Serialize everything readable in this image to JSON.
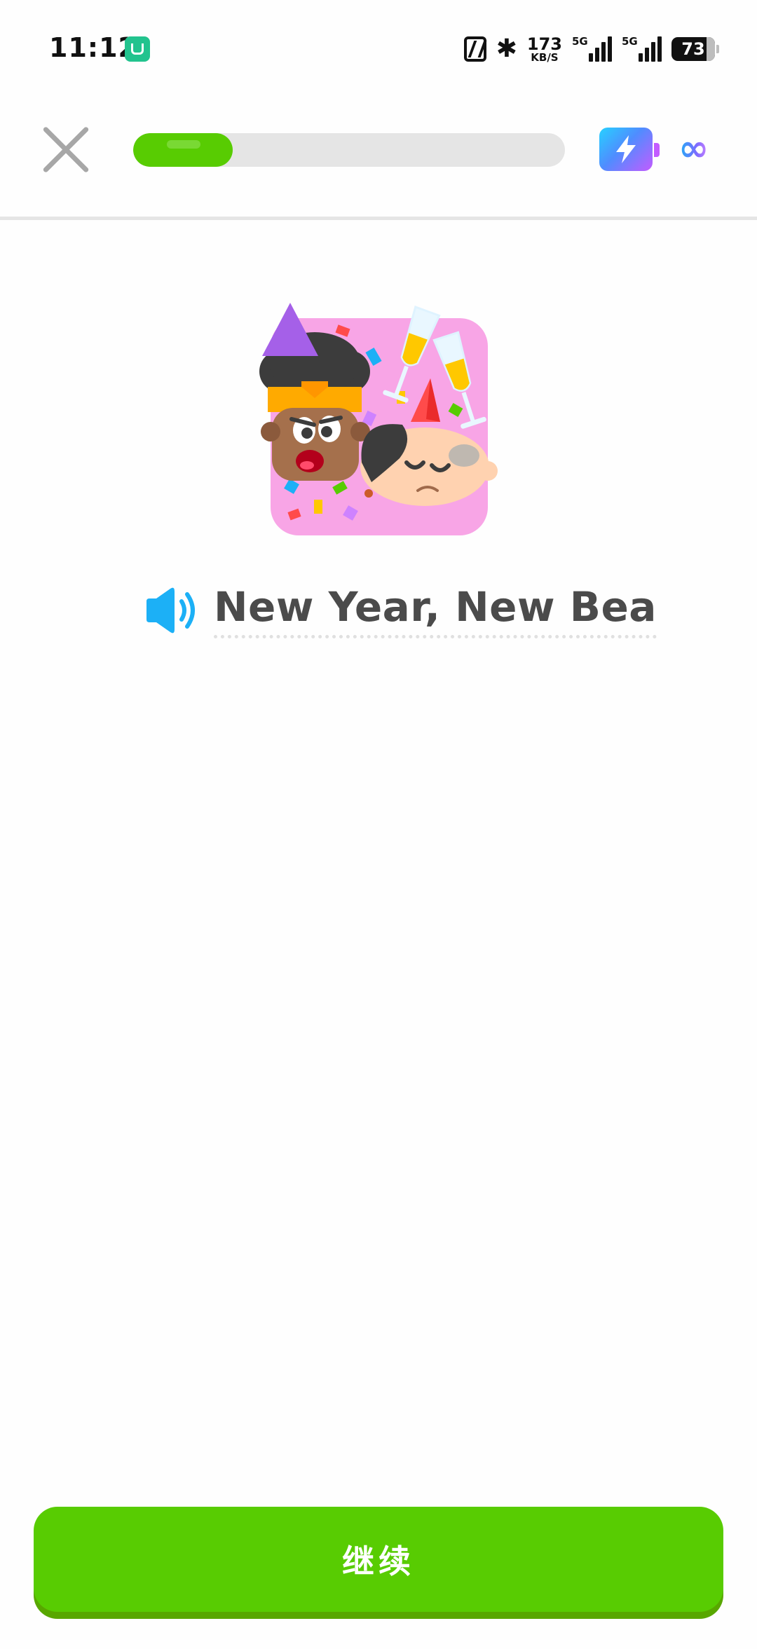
{
  "status_bar": {
    "time": "11:12",
    "speed_value": "173",
    "speed_unit": "KB/S",
    "signal1_label": "5G",
    "signal2_label": "5G",
    "battery": "73"
  },
  "lesson": {
    "progress": 0.23,
    "title": "New Year, New Bea"
  },
  "footer": {
    "continue_label": "继续"
  },
  "colors": {
    "progress": "#58cc02",
    "track": "#e5e5e5",
    "title": "#4b4b4b",
    "speaker": "#1cb0f6"
  },
  "icons": {
    "close": "close-icon",
    "energy": "energy-bolt-icon",
    "infinity": "infinity-icon",
    "speaker": "speaker-icon"
  }
}
